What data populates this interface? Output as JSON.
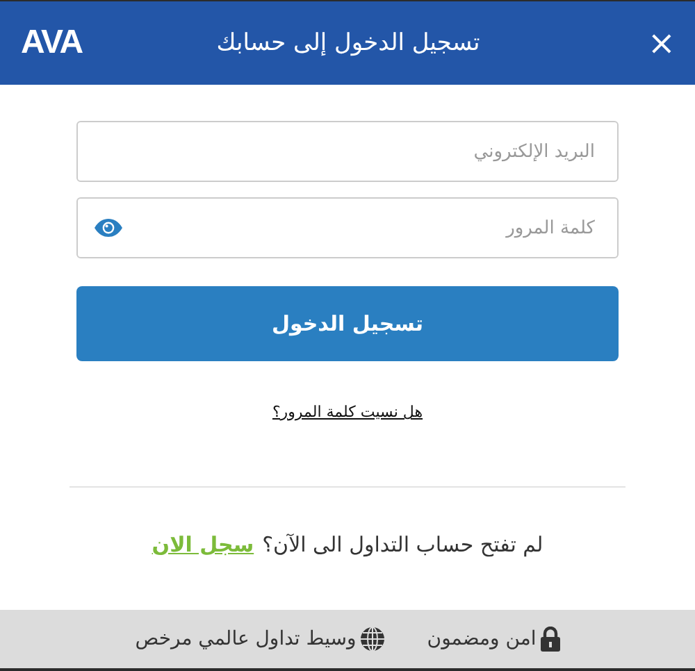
{
  "window": {
    "title": "تسجيل الدخول إلى حسابك",
    "logo": "AVA",
    "close": "×"
  },
  "form": {
    "email": {
      "placeholder": "البريد الإلكتروني"
    },
    "password": {
      "placeholder": "كلمة المرور"
    },
    "submit": "تسجيل الدخول",
    "forgot": "هل نسيت كلمة المرور؟"
  },
  "signup": {
    "text": "لم تفتح حساب التداول الى الآن؟",
    "link": "سجل الان"
  },
  "footer": [
    {
      "kind": "lock",
      "label": "امن ومضمون"
    },
    {
      "kind": "globe",
      "label": "وسيط تداول عالمي مرخص"
    }
  ]
}
